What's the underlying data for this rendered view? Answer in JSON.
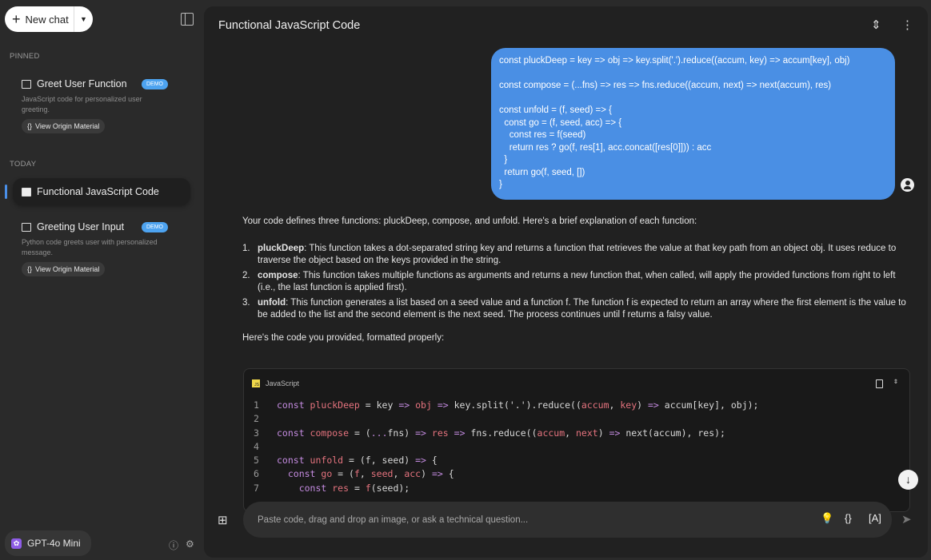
{
  "sidebar": {
    "new_chat": "New chat",
    "pinned_label": "PINNED",
    "today_label": "TODAY",
    "items": [
      {
        "title": "Greet User Function",
        "badge": "DEMO",
        "desc": "JavaScript code for personalized user greeting.",
        "origin": "View Origin Material"
      },
      {
        "title": "Functional JavaScript Code"
      },
      {
        "title": "Greeting User Input",
        "badge": "DEMO",
        "desc": "Python code greets user with personalized message.",
        "origin": "View Origin Material"
      }
    ],
    "model": "GPT-4o Mini"
  },
  "header": {
    "title": "Functional JavaScript Code"
  },
  "user_message": "const pluckDeep = key => obj => key.split('.').reduce((accum, key) => accum[key], obj)\n\nconst compose = (...fns) => res => fns.reduce((accum, next) => next(accum), res)\n\nconst unfold = (f, seed) => {\n  const go = (f, seed, acc) => {\n    const res = f(seed)\n    return res ? go(f, res[1], acc.concat([res[0]])) : acc\n  }\n  return go(f, seed, [])\n}",
  "answer": {
    "intro": "Your code defines three functions: pluckDeep, compose, and unfold. Here's a brief explanation of each function:",
    "items": [
      {
        "num": "1.",
        "term": "pluckDeep",
        "text": ": This function takes a dot-separated string key and returns a function that retrieves the value at that key path from an object obj. It uses reduce to traverse the object based on the keys provided in the string."
      },
      {
        "num": "2.",
        "term": "compose",
        "text": ": This function takes multiple functions as arguments and returns a new function that, when called, will apply the provided functions from right to left (i.e., the last function is applied first)."
      },
      {
        "num": "3.",
        "term": "unfold",
        "text": ": This function generates a list based on a seed value and a function f. The function f is expected to return an array where the first element is the value to be added to the list and the second element is the next seed. The process continues until f returns a falsy value."
      }
    ],
    "after": "Here's the code you provided, formatted properly:"
  },
  "code_block": {
    "language": "JavaScript",
    "lines": [
      [
        [
          "const ",
          "kw"
        ],
        [
          "pluckDeep",
          "fn"
        ],
        [
          " = key ",
          ""
        ],
        [
          "=>",
          "op"
        ],
        [
          " ",
          ""
        ],
        [
          "obj",
          "pm"
        ],
        [
          " ",
          ""
        ],
        [
          "=>",
          "op"
        ],
        [
          " key.split('.').reduce((",
          ""
        ],
        [
          "accum",
          "pm"
        ],
        [
          ", ",
          ""
        ],
        [
          "key",
          "pm"
        ],
        [
          ") ",
          ""
        ],
        [
          "=>",
          "op"
        ],
        [
          " accum[key], obj);",
          ""
        ]
      ],
      [],
      [
        [
          "const ",
          "kw"
        ],
        [
          "compose",
          "fn"
        ],
        [
          " = (",
          ""
        ],
        [
          "...",
          "op"
        ],
        [
          "fns) ",
          ""
        ],
        [
          "=>",
          "op"
        ],
        [
          " ",
          ""
        ],
        [
          "res",
          "pm"
        ],
        [
          " ",
          ""
        ],
        [
          "=>",
          "op"
        ],
        [
          " fns.reduce((",
          ""
        ],
        [
          "accum",
          "pm"
        ],
        [
          ", ",
          ""
        ],
        [
          "next",
          "pm"
        ],
        [
          ") ",
          ""
        ],
        [
          "=>",
          "op"
        ],
        [
          " next(accum), res);",
          ""
        ]
      ],
      [],
      [
        [
          "const ",
          "kw"
        ],
        [
          "unfold",
          "fn"
        ],
        [
          " = (f, seed) ",
          ""
        ],
        [
          "=>",
          "op"
        ],
        [
          " {",
          ""
        ]
      ],
      [
        [
          "  const ",
          "kw"
        ],
        [
          "go",
          "fn"
        ],
        [
          " = (",
          ""
        ],
        [
          "f",
          "pm"
        ],
        [
          ", ",
          ""
        ],
        [
          "seed",
          "pm"
        ],
        [
          ", ",
          ""
        ],
        [
          "acc",
          "pm"
        ],
        [
          ") ",
          ""
        ],
        [
          "=>",
          "op"
        ],
        [
          " {",
          ""
        ]
      ],
      [
        [
          "    const ",
          "kw"
        ],
        [
          "res",
          "fn"
        ],
        [
          " = ",
          ""
        ],
        [
          "f",
          "pm"
        ],
        [
          "(seed);",
          ""
        ]
      ]
    ]
  },
  "input": {
    "placeholder": "Paste code, drag and drop an image, or ask a technical question..."
  },
  "colors": {
    "accent": "#4a8fe4",
    "badge": "#4da3f0",
    "panel": "#212121",
    "sidebar": "#2a2a2a"
  }
}
